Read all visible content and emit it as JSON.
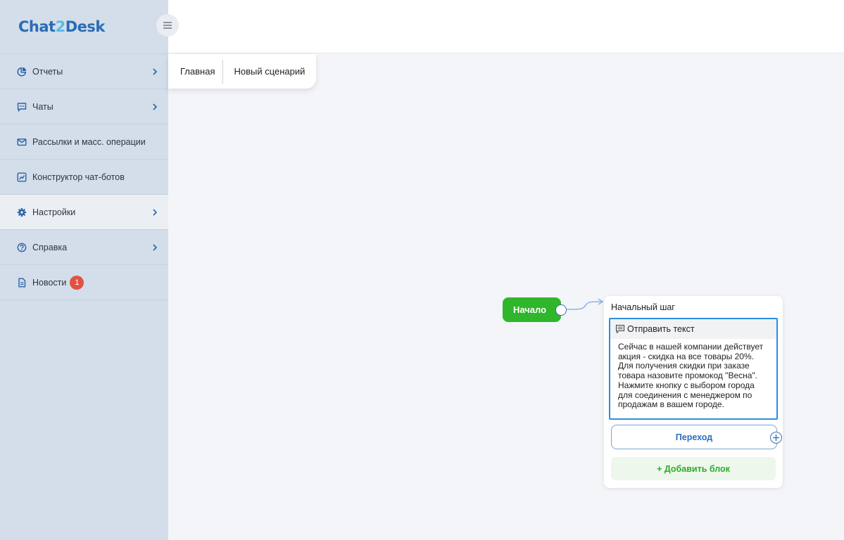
{
  "app": {
    "logo_part1": "Chat",
    "logo_part2": "2",
    "logo_part3": "Desk"
  },
  "sidebar": {
    "items": [
      {
        "label": "Отчеты",
        "icon": "pie-chart-icon",
        "has_arrow": true
      },
      {
        "label": "Чаты",
        "icon": "chat-icon",
        "has_arrow": true
      },
      {
        "label": "Рассылки и масс. операции",
        "icon": "envelope-icon",
        "has_arrow": false
      },
      {
        "label": "Конструктор чат-ботов",
        "icon": "trend-chart-icon",
        "has_arrow": false
      },
      {
        "label": "Настройки",
        "icon": "gear-icon",
        "has_arrow": true,
        "active": true
      },
      {
        "label": "Справка",
        "icon": "question-icon",
        "has_arrow": true
      },
      {
        "label": "Новости",
        "icon": "document-icon",
        "has_arrow": false,
        "badge": "1"
      }
    ]
  },
  "breadcrumb": {
    "home": "Главная",
    "current": "Новый сценарий"
  },
  "canvas": {
    "start_node": "Начало",
    "step": {
      "title": "Начальный шаг",
      "block_type": "Отправить текст",
      "message_lines": [
        "Сейчас в нашей компании действует",
        "акция - скидка на все товары 20%.",
        "Для получения скидки при заказе",
        "товара назовите промокод \"Весна\".",
        "Нажмите кнопку с выбором города",
        "для соединения с менеджером по",
        "продажам в вашем городе."
      ],
      "jump_button": "Переход",
      "add_block": "+ Добавить блок"
    }
  },
  "colors": {
    "sidebar_bg": "#d3deea",
    "accent_blue": "#2d8de0",
    "start_green": "#2fb62b",
    "badge_red": "#e25241"
  }
}
